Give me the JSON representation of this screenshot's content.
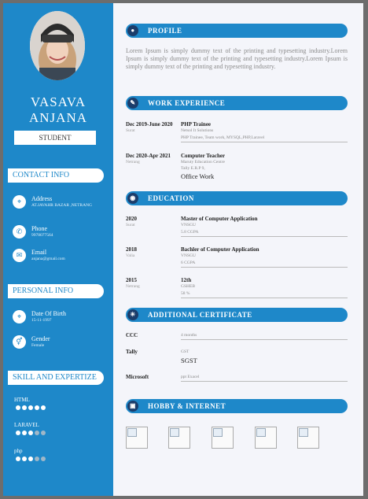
{
  "name": {
    "first": "VASAVA",
    "last": "ANJANA"
  },
  "role": "STUDENT",
  "contact": {
    "heading": "CONTACT INFO",
    "items": [
      {
        "icon": "map-pin-icon",
        "label": "Address",
        "value": "AT.JAVAHR BAZAR ,NETRANG"
      },
      {
        "icon": "phone-icon",
        "label": "Phone",
        "value": "9978077564"
      },
      {
        "icon": "mail-icon",
        "label": "Email",
        "value": "anjana@gmail.com"
      }
    ]
  },
  "personal": {
    "heading": "PERSONAL INFO",
    "items": [
      {
        "icon": "map-pin-icon",
        "label": "Date Of Birth",
        "value": "15-11-1997"
      },
      {
        "icon": "gender-icon",
        "label": "Gender",
        "value": "Female"
      }
    ]
  },
  "skills": {
    "heading": "SKILL AND EXPERTIZE",
    "items": [
      {
        "name": "HTML",
        "level": 5,
        "max": 5
      },
      {
        "name": "LARAVEL",
        "level": 3,
        "max": 5
      },
      {
        "name": "php",
        "level": 3,
        "max": 5
      }
    ]
  },
  "profile": {
    "heading": "PROFILE",
    "text": "Lorem Ipsum is simply dummy text of the printing and typesetting industry.Lorem Ipsum is simply dummy text of the printing and typesetting industry.Lorem Ipsum is simply dummy text of the printing and typesetting industry."
  },
  "experience": {
    "heading": "WORK EXPERIENCE",
    "items": [
      {
        "date": "Dec 2019-June 2020",
        "place": "Surat",
        "title": "PHP Trainee",
        "company": "Netsol It Solutions",
        "detail": "PHP Trainee, Team work, MYSQL,PHP,Laravel",
        "extra": ""
      },
      {
        "date": "Dec 2020-Apr 2021",
        "place": "Netrang",
        "title": "Computer Teacher",
        "company": "Maruty Education Centre",
        "detail": "Tally E.R.P 9,",
        "extra": "Office Work"
      }
    ]
  },
  "education": {
    "heading": "EDUCATION",
    "items": [
      {
        "year": "2020",
        "place": "Surat",
        "degree": "Master of Computer Application",
        "board": "VNSGU",
        "score": "5.8 CGPA"
      },
      {
        "year": "2018",
        "place": "Valia",
        "degree": "Bachler of Computer Application",
        "board": "VNSGU",
        "score": "6 CGPA"
      },
      {
        "year": "2015",
        "place": "Netrang",
        "degree": "12th",
        "board": "GSHEB",
        "score": "58 %"
      }
    ]
  },
  "certificates": {
    "heading": "ADDITIONAL CERTIFICATE",
    "items": [
      {
        "name": "CCC",
        "detail": "4 months",
        "extra": ""
      },
      {
        "name": "Tally",
        "detail": "GST",
        "extra": "SGST"
      },
      {
        "name": "Microsoft",
        "detail": "ppt Exacel",
        "extra": ""
      }
    ]
  },
  "hobby": {
    "heading": "HOBBY & INTERNET",
    "count": 5
  },
  "colors": {
    "accent": "#1e88c9",
    "icon_dark": "#1b3d6b",
    "dot_on": "#ffffff",
    "dot_off": "#9fb7c8"
  }
}
